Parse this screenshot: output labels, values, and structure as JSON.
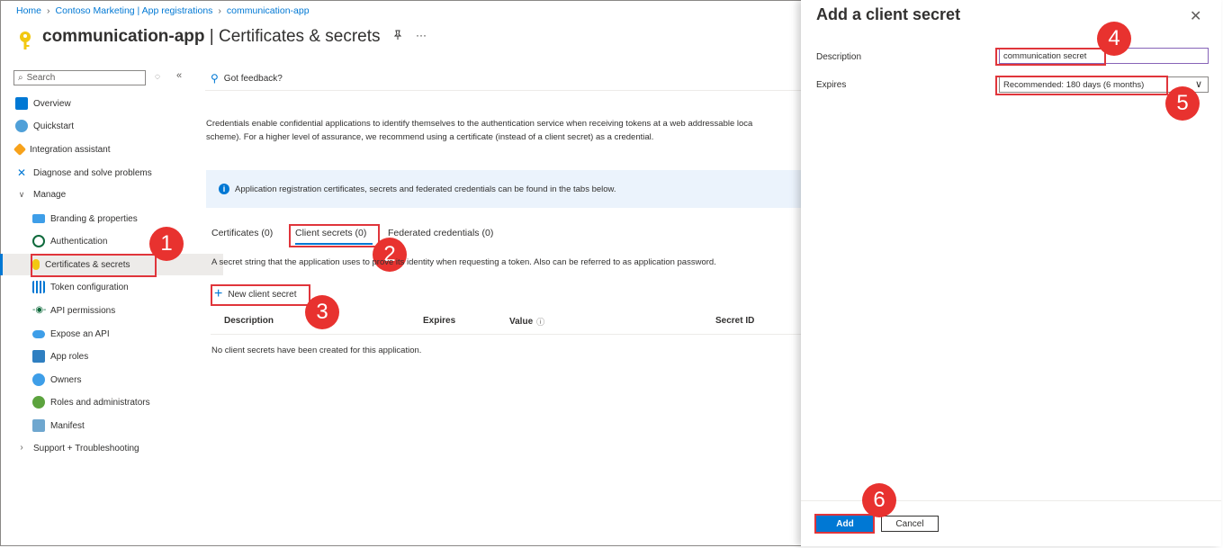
{
  "breadcrumb": [
    "Home",
    "Contoso Marketing | App registrations",
    "communication-app"
  ],
  "header": {
    "app_name": "communication-app",
    "page_section": "| Certificates & secrets",
    "more": "···"
  },
  "sidebar": {
    "search_placeholder": "Search",
    "items": [
      {
        "label": "Overview",
        "icon": "overview-icon"
      },
      {
        "label": "Quickstart",
        "icon": "quickstart-icon"
      },
      {
        "label": "Integration assistant",
        "icon": "rocket-icon"
      },
      {
        "label": "Diagnose and solve problems",
        "icon": "wrench-icon"
      },
      {
        "label": "Manage",
        "icon": "chevron-down-icon"
      },
      {
        "label": "Branding & properties",
        "icon": "branding-icon"
      },
      {
        "label": "Authentication",
        "icon": "authentication-icon"
      },
      {
        "label": "Certificates & secrets",
        "icon": "key-icon"
      },
      {
        "label": "Token configuration",
        "icon": "token-icon"
      },
      {
        "label": "API permissions",
        "icon": "api-permissions-icon"
      },
      {
        "label": "Expose an API",
        "icon": "cloud-icon"
      },
      {
        "label": "App roles",
        "icon": "app-roles-icon"
      },
      {
        "label": "Owners",
        "icon": "owners-icon"
      },
      {
        "label": "Roles and administrators",
        "icon": "roles-icon"
      },
      {
        "label": "Manifest",
        "icon": "manifest-icon"
      },
      {
        "label": "Support + Troubleshooting",
        "icon": "chevron-right-icon"
      }
    ]
  },
  "toolbar": {
    "feedback": "Got feedback?"
  },
  "main": {
    "description_line1": "Credentials enable confidential applications to identify themselves to the authentication service when receiving tokens at a web addressable loca",
    "description_line2": "scheme). For a higher level of assurance, we recommend using a certificate (instead of a client secret) as a credential.",
    "info_banner": "Application registration certificates, secrets and federated credentials can be found in the tabs below.",
    "tabs": [
      "Certificates (0)",
      "Client secrets (0)",
      "Federated credentials (0)"
    ],
    "tab_description": "A secret string that the application uses to prove its identity when requesting a token. Also can be referred to as application password.",
    "new_secret_button": "New client secret",
    "table_headers": [
      "Description",
      "Expires",
      "Value",
      "Secret ID"
    ],
    "empty_message": "No client secrets have been created for this application."
  },
  "panel": {
    "title": "Add a client secret",
    "description_label": "Description",
    "description_value": "communication secret",
    "expires_label": "Expires",
    "expires_value": "Recommended: 180 days (6 months)",
    "add_button": "Add",
    "cancel_button": "Cancel"
  },
  "callouts": [
    "1",
    "2",
    "3",
    "4",
    "5",
    "6"
  ],
  "colors": {
    "accent": "#0078d4",
    "callout": "#e8322f",
    "highlight_border": "#e0353b",
    "info_bg": "#ebf3fc"
  }
}
